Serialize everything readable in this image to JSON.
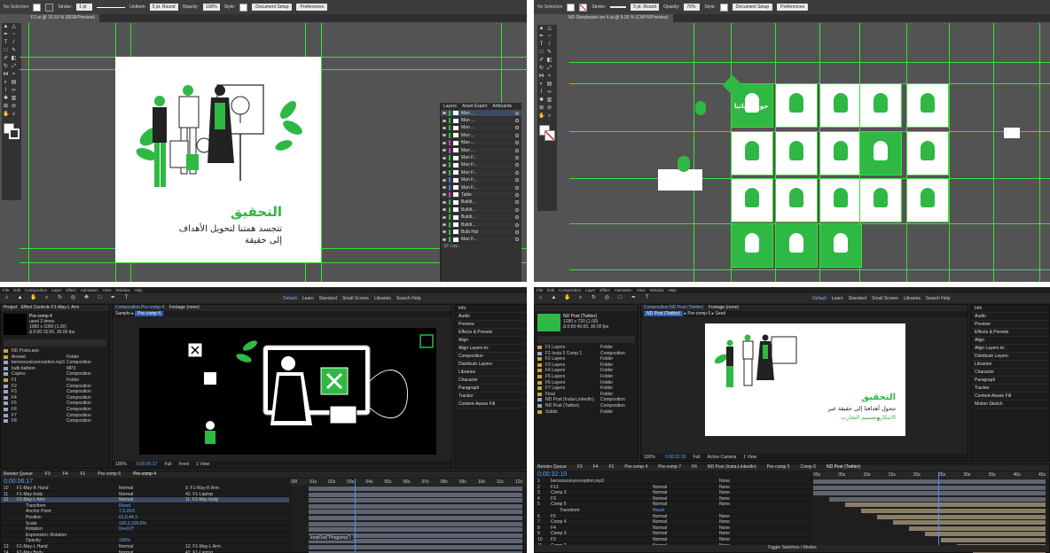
{
  "ai1": {
    "control": {
      "selection": "No Selection",
      "stroke_label": "Stroke:",
      "stroke_value": "1 pt",
      "uniform": "Uniform",
      "brush": "5 pt. Round",
      "opacity_label": "Opacity:",
      "opacity_value": "100%",
      "style_label": "Style:",
      "doc_setup": "Document Setup",
      "prefs": "Preferences"
    },
    "tab": "F3.ai @ 33.33 % (RGB/Preview)",
    "artboard": {
      "heading": "التحقيق",
      "line1": "تتجسد همتنا لتحويل الأهداف",
      "line2": "إلى حقيقة"
    },
    "layers": {
      "tabs": [
        "Layers",
        "Asset Export",
        "Artboards"
      ],
      "rows": [
        "Man ...",
        "Man ...",
        "Man ...",
        "Man ...",
        "Man ...",
        "Man ...",
        "Man F...",
        "Man F...",
        "Man F...",
        "Man F...",
        "Man F...",
        "Table",
        "Buildi...",
        "Buildi...",
        "Buildi...",
        "Buildi...",
        "Bulb Hat",
        "Man F..."
      ],
      "footer": "SF Lay..."
    },
    "colors": {
      "accent": "#2fb844",
      "guide": "#3adf3a"
    }
  },
  "ai2": {
    "control": {
      "selection": "No Selection",
      "stroke_label": "Stroke:",
      "brush": "5 pt. Round",
      "opacity_label": "Opacity:",
      "opacity_value": "70%",
      "style_label": "Style:",
      "doc_setup": "Document Setup",
      "prefs": "Preferences"
    },
    "tab": "ND Storyboard ver 4.ai @ 6.25 % (CMYK/Preview)",
    "headline": "جودة حياتنا"
  },
  "ae1": {
    "menu": [
      "File",
      "Edit",
      "Composition",
      "Layer",
      "Effect",
      "Animation",
      "View",
      "Window",
      "Help"
    ],
    "workspaces": [
      "Default",
      "Learn",
      "Standard",
      "Small Screen",
      "Libraries"
    ],
    "search": "Search Help",
    "project": {
      "title": "Project",
      "effects": "Effect Controls F1-May-L Arm",
      "item": "Pre-comp 4",
      "used": "used 2 times",
      "size": "1080 x 1080 (1.00)",
      "dur": "Δ 0:00:15:00, 30.00 fps",
      "file": "ND Posts.aep",
      "files": [
        "Arrowd",
        "berosound-perception.mp3",
        "bulb balloon",
        "Copies",
        "F1",
        "F2",
        "F3",
        "F4",
        "F5",
        "F6",
        "F7",
        "F8"
      ],
      "types": [
        "Folder",
        "Composition",
        "MP3",
        "Composition",
        "Folder",
        "Composition",
        "Composition",
        "Composition",
        "Composition",
        "Composition",
        "Composition",
        "Composition"
      ]
    },
    "comp": {
      "tabs": [
        "Composition Pre-comp 4",
        "Footage (none)"
      ],
      "sub": [
        "Sample",
        "Pre-comp 4"
      ],
      "zoom": "100%",
      "tc": "0;00:06:17",
      "full": "Full",
      "front": "Front",
      "view": "1 View"
    },
    "right": [
      "Info",
      "Audio",
      "Preview",
      "Effects & Presets",
      "Align",
      "Align Layers to:",
      "Composition",
      "Distribute Layers:",
      "Libraries",
      "Character",
      "Paragraph",
      "Tracker",
      "Content-Aware Fill"
    ],
    "tl_tabs": [
      "Render Queue",
      "F3",
      "F4",
      "F1",
      "Pre-comp 6",
      "Pre-comp 4"
    ],
    "timecode": "0;00:06:17",
    "rows": [
      {
        "n": "10",
        "name": "F1-May-R Hand",
        "mode": "Normal",
        "parent": "9. F1-May-R Arm"
      },
      {
        "n": "11",
        "name": "F1-May body",
        "mode": "Normal",
        "parent": "42. F1-Laptop"
      },
      {
        "n": "12",
        "name": "F1-May-L Arm",
        "mode": "Normal",
        "parent": "11. F1-May body"
      },
      {
        "n": "",
        "name": "Transform",
        "mode": "Reset",
        "parent": ""
      },
      {
        "n": "",
        "name": "Anchor Point",
        "mode": "7.3,29.5",
        "parent": ""
      },
      {
        "n": "",
        "name": "Position",
        "mode": "61.6,44.3",
        "parent": ""
      },
      {
        "n": "",
        "name": "Scale",
        "mode": "100.0,100.0%",
        "parent": ""
      },
      {
        "n": "",
        "name": "Rotation",
        "mode": "0x+0.0°",
        "parent": ""
      },
      {
        "n": "",
        "name": "Expression: Rotation",
        "mode": "",
        "parent": ""
      },
      {
        "n": "",
        "name": "Opacity",
        "mode": "100%",
        "parent": ""
      },
      {
        "n": "13",
        "name": "F1-May-L Hand",
        "mode": "Normal",
        "parent": "12. F1-May-L Arm"
      },
      {
        "n": "14",
        "name": "F1-May Body",
        "mode": "Normal",
        "parent": "42. F1-Laptop"
      }
    ],
    "expression": "loopOut(\"Pingpong\")",
    "ticks": [
      "00f",
      "01s",
      "02s",
      "03s",
      "04s",
      "05s",
      "06s",
      "07s",
      "08s",
      "09s",
      "10s",
      "11s",
      "12s"
    ]
  },
  "ae2": {
    "menu": [
      "File",
      "Edit",
      "Composition",
      "Layer",
      "Effect",
      "Animation",
      "View",
      "Window",
      "Help"
    ],
    "workspaces": [
      "Default",
      "Learn",
      "Standard",
      "Small Screen",
      "Libraries"
    ],
    "search": "Search Help",
    "project": {
      "item": "ND Post (Twitter)",
      "size": "1280 x 720 (1.00)",
      "dur": "Δ 0:00:45:00, 30.00 fps",
      "files": [
        "F1 Layers",
        "F1 Insta 5 Comp 1",
        "F2 Layers",
        "F3 Layers",
        "F4 Layers",
        "F5 Layers",
        "F6 Layers",
        "F7 Layers",
        "Final",
        "ND Post (Insta-LinkedIn)",
        "ND Post (Twitter)",
        "Solids"
      ],
      "types": [
        "Folder",
        "Composition",
        "Folder",
        "Folder",
        "Folder",
        "Folder",
        "Folder",
        "Folder",
        "Folder",
        "Composition",
        "Composition",
        "Folder"
      ]
    },
    "comp": {
      "tabs": [
        "Composition ND Post (Twitter)",
        "Footage (none)"
      ],
      "sub": [
        "ND Post (Twitter)",
        "Pre-comp 6",
        "Seed"
      ],
      "zoom": "100%",
      "tc": "0;00:32:10",
      "full": "Full",
      "camera": "Active Camera",
      "view": "1 View"
    },
    "poster": {
      "heading": "التحقيق",
      "line1": "تتحول أهدافنا إلى حقيقة عبر",
      "line2a": "الابتكار",
      "line2b": "و",
      "line2c": "تصميم التجارب"
    },
    "right": [
      "Info",
      "Audio",
      "Preview",
      "Effects & Presets",
      "Align",
      "Align Layers to:",
      "Distribute Layers:",
      "Libraries",
      "Character",
      "Paragraph",
      "Tracker",
      "Content-Aware Fill",
      "Motion Sketch"
    ],
    "tl_tabs": [
      "Render Queue",
      "F3",
      "F4",
      "F1",
      "Pre-comp 4",
      "Pre-comp 7",
      "F6",
      "ND Post (Insta-LinkedIn)",
      "Pre-comp 2",
      "Comp 6",
      "ND Post (Twitter)"
    ],
    "timecode": "0;00:32:10",
    "rows": [
      {
        "n": "1",
        "name": "berosound-perception.mp3",
        "mode": "",
        "parent": "None"
      },
      {
        "n": "2",
        "name": "F13",
        "mode": "Normal",
        "parent": "None"
      },
      {
        "n": "3",
        "name": "Comp 3",
        "mode": "Normal",
        "parent": "None"
      },
      {
        "n": "4",
        "name": "F3",
        "mode": "Normal",
        "parent": "None"
      },
      {
        "n": "5",
        "name": "Comp 5",
        "mode": "Normal",
        "parent": "None"
      },
      {
        "n": "",
        "name": "Transform",
        "mode": "Reset",
        "parent": ""
      },
      {
        "n": "6",
        "name": "F5",
        "mode": "Normal",
        "parent": "None"
      },
      {
        "n": "7",
        "name": "Comp 4",
        "mode": "Normal",
        "parent": "None"
      },
      {
        "n": "8",
        "name": "F4",
        "mode": "Normal",
        "parent": "None"
      },
      {
        "n": "9",
        "name": "Comp 3",
        "mode": "Normal",
        "parent": "None"
      },
      {
        "n": "10",
        "name": "F3",
        "mode": "Normal",
        "parent": "None"
      },
      {
        "n": "11",
        "name": "Comp 2",
        "mode": "Normal",
        "parent": "None"
      },
      {
        "n": "12",
        "name": "F2",
        "mode": "Normal",
        "parent": "None"
      }
    ],
    "ticks": [
      "00s",
      "05s",
      "10s",
      "15s",
      "20s",
      "25s",
      "30s",
      "35s",
      "40s",
      "45s"
    ],
    "footer": "Toggle Switches / Modes"
  }
}
